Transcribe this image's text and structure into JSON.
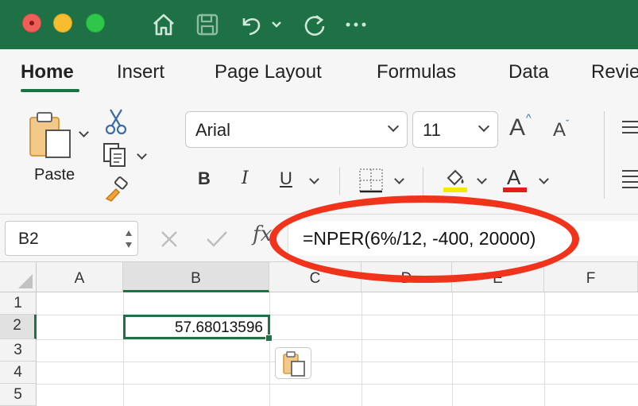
{
  "tabs": [
    {
      "label": "Home",
      "active": true
    },
    {
      "label": "Insert"
    },
    {
      "label": "Page Layout"
    },
    {
      "label": "Formulas"
    },
    {
      "label": "Data"
    },
    {
      "label": "Revie"
    }
  ],
  "ribbon": {
    "paste_label": "Paste",
    "font_name": "Arial",
    "font_size": "11",
    "bold": "B",
    "italic": "I",
    "underline": "U",
    "font_color_glyph": "A",
    "grow_font": "A",
    "shrink_font": "A"
  },
  "formula_bar": {
    "name_box": "B2",
    "fx_label": "fx",
    "formula": "=NPER(6%/12, -400, 20000)"
  },
  "grid": {
    "columns": [
      "A",
      "B",
      "C",
      "D",
      "E",
      "F"
    ],
    "rows": [
      "1",
      "2",
      "3",
      "4",
      "5"
    ],
    "selected_cell_value": "57.68013596"
  },
  "colors": {
    "accent": "#1e7145",
    "annotation": "#f2331b",
    "highlight": "#f7e900",
    "font_color": "#e31c1c"
  }
}
